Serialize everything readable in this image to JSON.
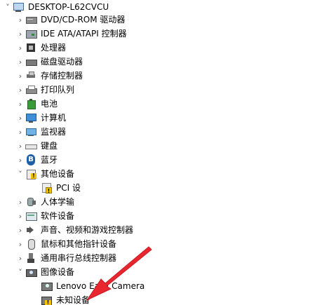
{
  "root": {
    "label": "DESKTOP-L62CVCU",
    "expanded": true,
    "icon": "computer-icon"
  },
  "categories": [
    {
      "label": "DVD/CD-ROM 驱动器",
      "icon": "dvd-drive-icon",
      "expanded": false
    },
    {
      "label": "IDE ATA/ATAPI 控制器",
      "icon": "ide-controller-icon",
      "expanded": false
    },
    {
      "label": "处理器",
      "icon": "processor-icon",
      "expanded": false
    },
    {
      "label": "磁盘驱动器",
      "icon": "disk-drive-icon",
      "expanded": false
    },
    {
      "label": "存储控制器",
      "icon": "storage-controller-icon",
      "expanded": false
    },
    {
      "label": "打印队列",
      "icon": "printer-icon",
      "expanded": false
    },
    {
      "label": "电池",
      "icon": "battery-icon",
      "expanded": false
    },
    {
      "label": "计算机",
      "icon": "computer-monitor-icon",
      "expanded": false
    },
    {
      "label": "监视器",
      "icon": "display-monitor-icon",
      "expanded": false
    },
    {
      "label": "键盘",
      "icon": "keyboard-icon",
      "expanded": false
    },
    {
      "label": "蓝牙",
      "icon": "bluetooth-icon",
      "expanded": false
    },
    {
      "label": "其他设备",
      "icon": "other-devices-icon",
      "expanded": true,
      "children": [
        {
          "label": "PCI 设",
          "icon": "warning-device-icon"
        }
      ]
    },
    {
      "label": "人体学输​",
      "icon": "hid-icon",
      "expanded": false
    },
    {
      "label": "软件设备",
      "icon": "software-device-icon",
      "expanded": false
    },
    {
      "label": "声音、视频和游戏控制器",
      "icon": "sound-icon",
      "expanded": false
    },
    {
      "label": "鼠标和其他指针设备",
      "icon": "mouse-icon",
      "expanded": false
    },
    {
      "label": "通用串行总线控制器",
      "icon": "usb-icon",
      "expanded": false
    },
    {
      "label": "图像设备",
      "icon": "camera-icon",
      "expanded": true,
      "children": [
        {
          "label": "Lenovo Easy Camera",
          "icon": "camera-device-icon"
        },
        {
          "label": "未知设备",
          "icon": "unknown-device-warning-icon"
        }
      ]
    }
  ],
  "glyphs": {
    "collapsed": "›",
    "expanded": "˅"
  },
  "annotation": {
    "color": "#e8262f",
    "icon": "red-arrow-annotation"
  }
}
